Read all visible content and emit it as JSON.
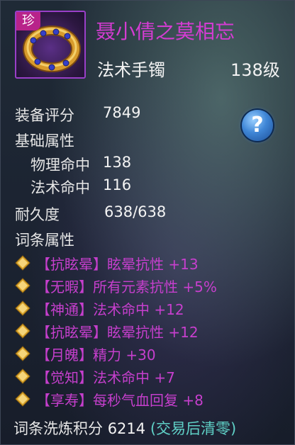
{
  "item": {
    "rarity_badge": "珍",
    "name": "聂小倩之莫相忘",
    "type": "法术手镯",
    "level": "138级",
    "icon": "bracelet-icon"
  },
  "stats": {
    "equip_score_label": "装备评分",
    "equip_score_value": "7849",
    "base_attr_title": "基础属性",
    "physical_hit_label": "物理命中",
    "physical_hit_value": "138",
    "magic_hit_label": "法术命中",
    "magic_hit_value": "116",
    "durability_label": "耐久度",
    "durability_value": "638/638",
    "affix_title": "词条属性"
  },
  "help": {
    "label": "?"
  },
  "affixes": [
    {
      "text": "【抗眩晕】眩晕抗性 +13"
    },
    {
      "text": "【无暇】所有元素抗性 +5%"
    },
    {
      "text": "【神通】法术命中 +12"
    },
    {
      "text": "【抗眩晕】眩晕抗性 +12"
    },
    {
      "text": "【月魄】精力 +30"
    },
    {
      "text": "【觉知】法术命中 +7"
    },
    {
      "text": "【享寿】每秒气血回复 +8"
    }
  ],
  "footer": {
    "label": "词条洗炼积分",
    "value": "6214",
    "note": "(交易后清零)"
  },
  "colors": {
    "item_name": "#d43cd2",
    "affix_text": "#c63fcd",
    "note": "#5fd0c6",
    "rarity_badge": "#b8238a",
    "icon_border": "#9a3fc8"
  }
}
